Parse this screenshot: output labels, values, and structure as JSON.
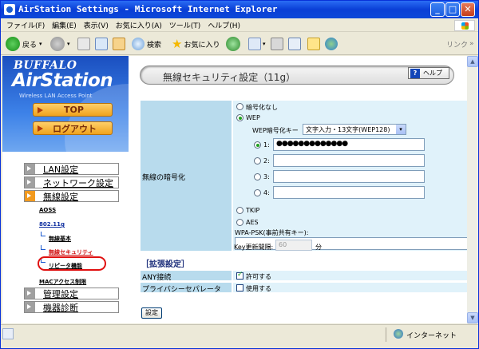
{
  "window": {
    "title": "AirStation Settings - Microsoft Internet Explorer",
    "min": "_",
    "max": "□",
    "close": "✕"
  },
  "menu": [
    "ファイル(F)",
    "編集(E)",
    "表示(V)",
    "お気に入り(A)",
    "ツール(T)",
    "ヘルプ(H)"
  ],
  "toolbar": {
    "back": "戻る",
    "search": "検索",
    "favorites": "お気に入り",
    "links": "リンク",
    "link_chevron": "»"
  },
  "brand": {
    "maker": "BUFFALO",
    "product": "AirStation",
    "subtitle": "Wireless LAN Access Point"
  },
  "top_buttons": {
    "top": "TOP",
    "logout": "ログアウト"
  },
  "nav": {
    "lan": "LAN設定",
    "network": "ネットワーク設定",
    "wireless": "無線設定",
    "aoss": "AOSS",
    "band": "802.11g",
    "basic": "無線基本",
    "security": "無線セキュリティ",
    "repeater": "リピータ機能",
    "mac": "MACアクセス制限",
    "admin": "管理設定",
    "diag": "機器診断"
  },
  "main": {
    "title": "無線セキュリティ設定（11g）",
    "help": "ヘルプ",
    "help_icon": "?",
    "encryption_label": "無線の暗号化",
    "opt_none": "暗号化なし",
    "opt_wep": "WEP",
    "wep_key_label": "WEP暗号化キー",
    "wep_key_type": "文字入力・13文字(WEP128)",
    "keys": [
      {
        "label": "1:",
        "value": "●●●●●●●●●●●●●",
        "selected": true
      },
      {
        "label": "2:",
        "value": "",
        "selected": false
      },
      {
        "label": "3:",
        "value": "",
        "selected": false
      },
      {
        "label": "4:",
        "value": "",
        "selected": false
      }
    ],
    "opt_tkip": "TKIP",
    "opt_aes": "AES",
    "wpa_label": "WPA-PSK(事前共有キー):",
    "key_interval_label": "Key更新間隔:",
    "key_interval_value": "60",
    "key_interval_unit": "分",
    "ext_section": "［拡張設定］",
    "any_label": "ANY接続",
    "any_value": "許可する",
    "privacy_label": "プライバシーセパレータ",
    "privacy_value": "使用する",
    "submit": "設定"
  },
  "status": {
    "zone": "インターネット"
  }
}
